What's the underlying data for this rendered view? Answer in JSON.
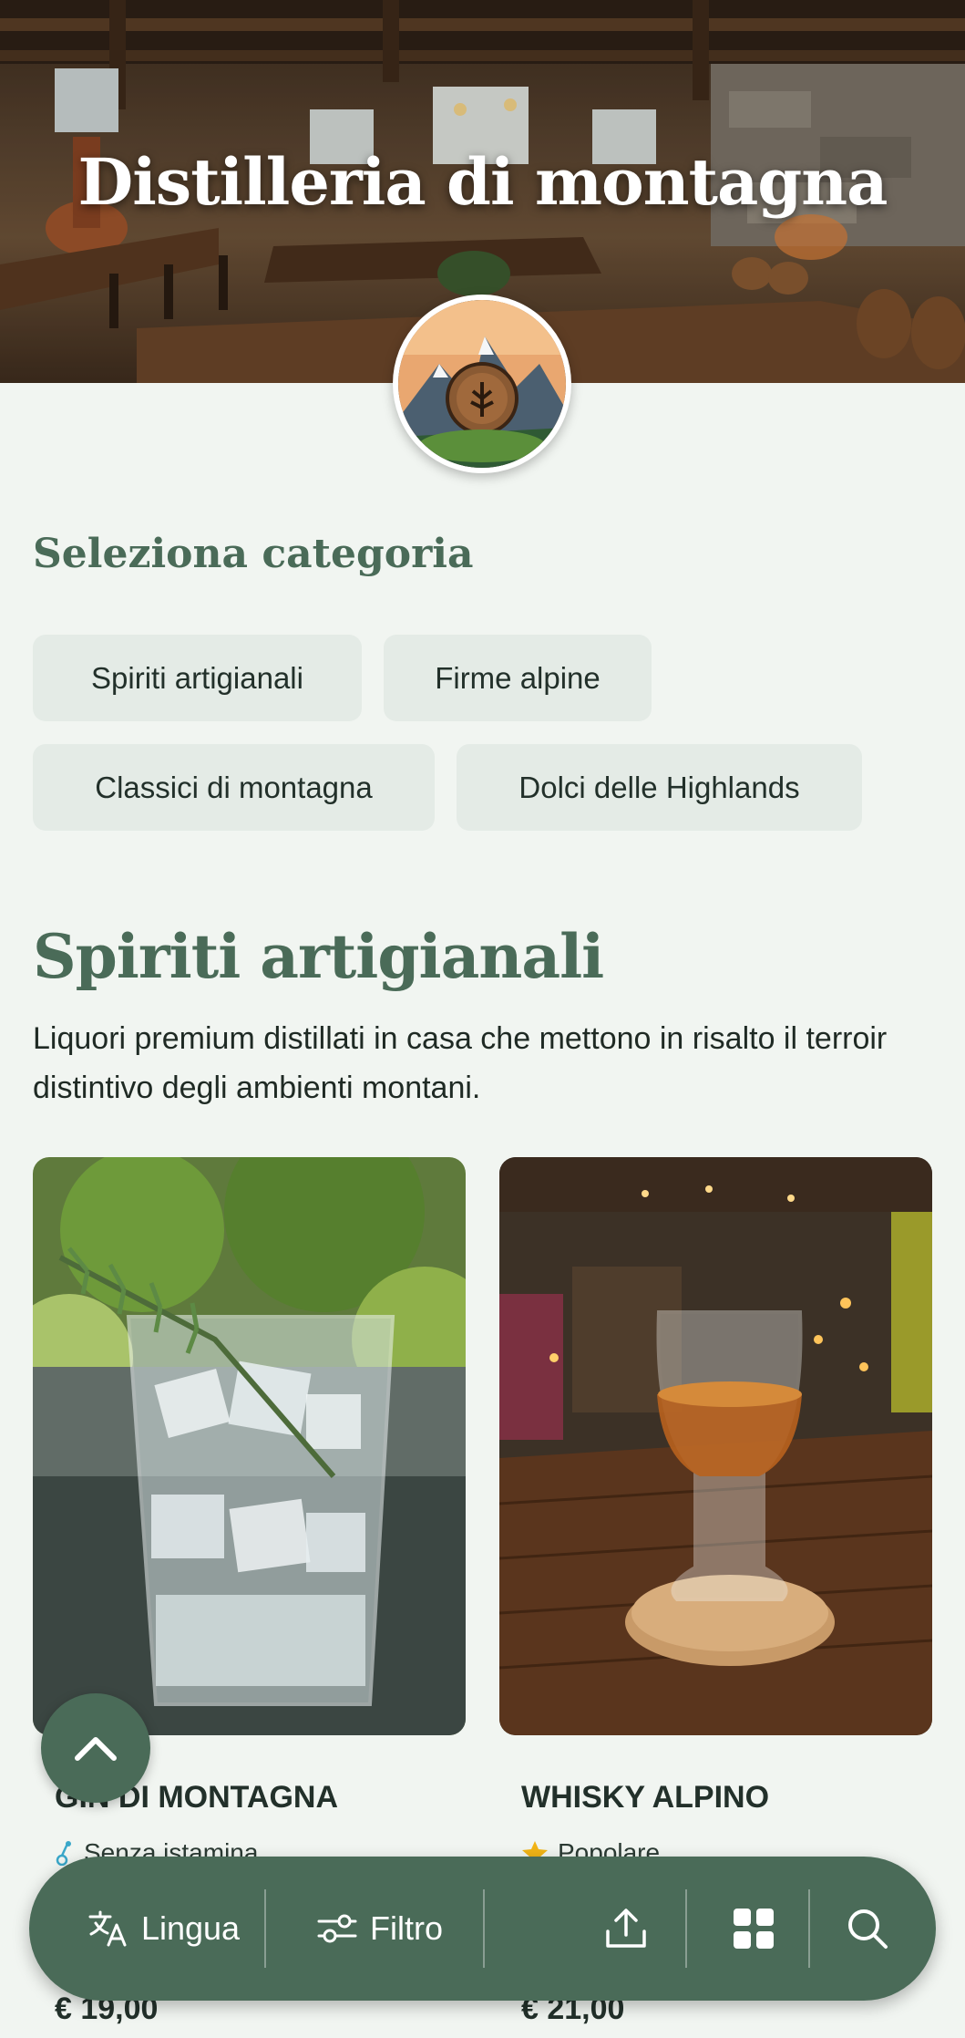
{
  "hero": {
    "title": "Distilleria di montagna"
  },
  "categories": {
    "heading": "Seleziona categoria",
    "chips": [
      "Spiriti artigianali",
      "Firme alpine",
      "Classici di montagna",
      "Dolci delle Highlands"
    ]
  },
  "section": {
    "title": "Spiriti artigianali",
    "description": "Liquori premium distillati in casa che mettono in risalto il terroir distintivo degli ambienti montani."
  },
  "products": [
    {
      "name": "GIN DI MONTAGNA",
      "tag": "Senza istamina",
      "tag_icon": "histamine-free-icon",
      "price": "€ 19,00"
    },
    {
      "name": "WHISKY ALPINO",
      "tag": "Popolare",
      "tag_icon": "star-icon",
      "price": "€ 21,00"
    }
  ],
  "toolbar": {
    "language_label": "Lingua",
    "filter_label": "Filtro",
    "icons": [
      "translate-icon",
      "filter-icon",
      "share-icon",
      "grid-icon",
      "search-icon"
    ]
  },
  "colors": {
    "accent": "#4a6b58",
    "background": "#f1f5f1",
    "chip": "#e4ebe6",
    "star": "#f2b416"
  }
}
